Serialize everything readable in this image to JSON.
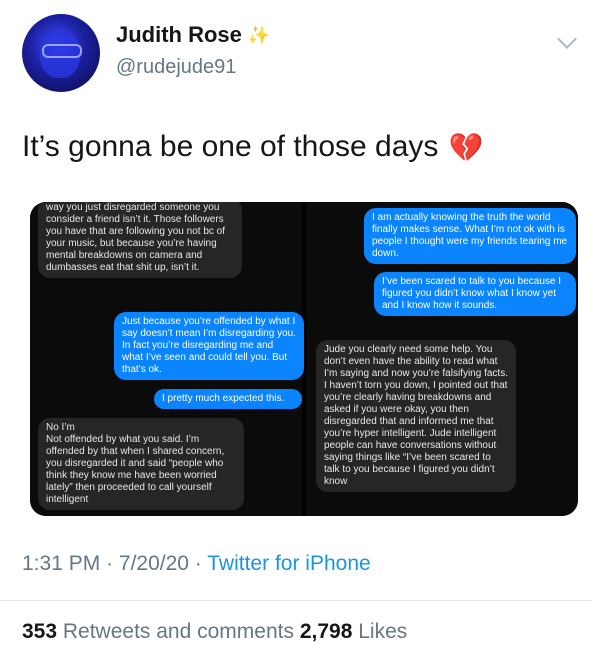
{
  "header": {
    "display_name": "Judith Rose",
    "verified_icon": "sparkle-icon",
    "handle": "@rudejude91"
  },
  "tweet": {
    "text": "It’s gonna be one of those days",
    "emoji": "💔"
  },
  "left_panel": {
    "messages": [
      {
        "type": "received",
        "text": "way you just disregarded someone you consider a friend isn’t it. Those followers you have that are following you not bc of your music, but because you’re having mental breakdowns on camera and dumbasses eat that shit up, isn’t it."
      },
      {
        "type": "sent",
        "text": "Just because you’re offended by what I say doesn’t mean I’m disregarding you. In fact you’re disregarding me and what I’ve seen and could tell you. But that’s ok."
      },
      {
        "type": "sent",
        "text": "I pretty much expected this."
      },
      {
        "type": "received",
        "text": "No I’m\nNot offended by what you said. I’m offended by that when I shared concern, you disregarded it and said “people who think they know me have been worried lately” then proceeded to call yourself intelligent"
      }
    ]
  },
  "right_panel": {
    "messages": [
      {
        "type": "sent",
        "text": "I am actually knowing the truth the world finally makes sense. What I’m not ok with is people I thought were my friends tearing me down."
      },
      {
        "type": "sent",
        "text": "I’ve been scared to talk to you because I figured you didn’t know what I know yet and I know how it sounds."
      },
      {
        "type": "received",
        "text": "Jude you clearly need some help. You don’t even have the ability to read what I’m saying and now you’re falsifying facts. I haven’t torn you down, I pointed out that you’re clearly having breakdowns and asked if you were okay, you then disregarded that and informed me that you’re hyper intelligent. Jude intelligent people can have conversations without saying things like “I’ve been scared to talk to you because I figured you didn’t know"
      }
    ]
  },
  "meta": {
    "time": "1:31 PM",
    "sep1": " · ",
    "date": "7/20/20",
    "sep2": " · ",
    "source": "Twitter for iPhone"
  },
  "stats": {
    "retweets_count": "353",
    "retweets_label": " Retweets and comments  ",
    "likes_count": "2,798",
    "likes_label": " Likes"
  }
}
